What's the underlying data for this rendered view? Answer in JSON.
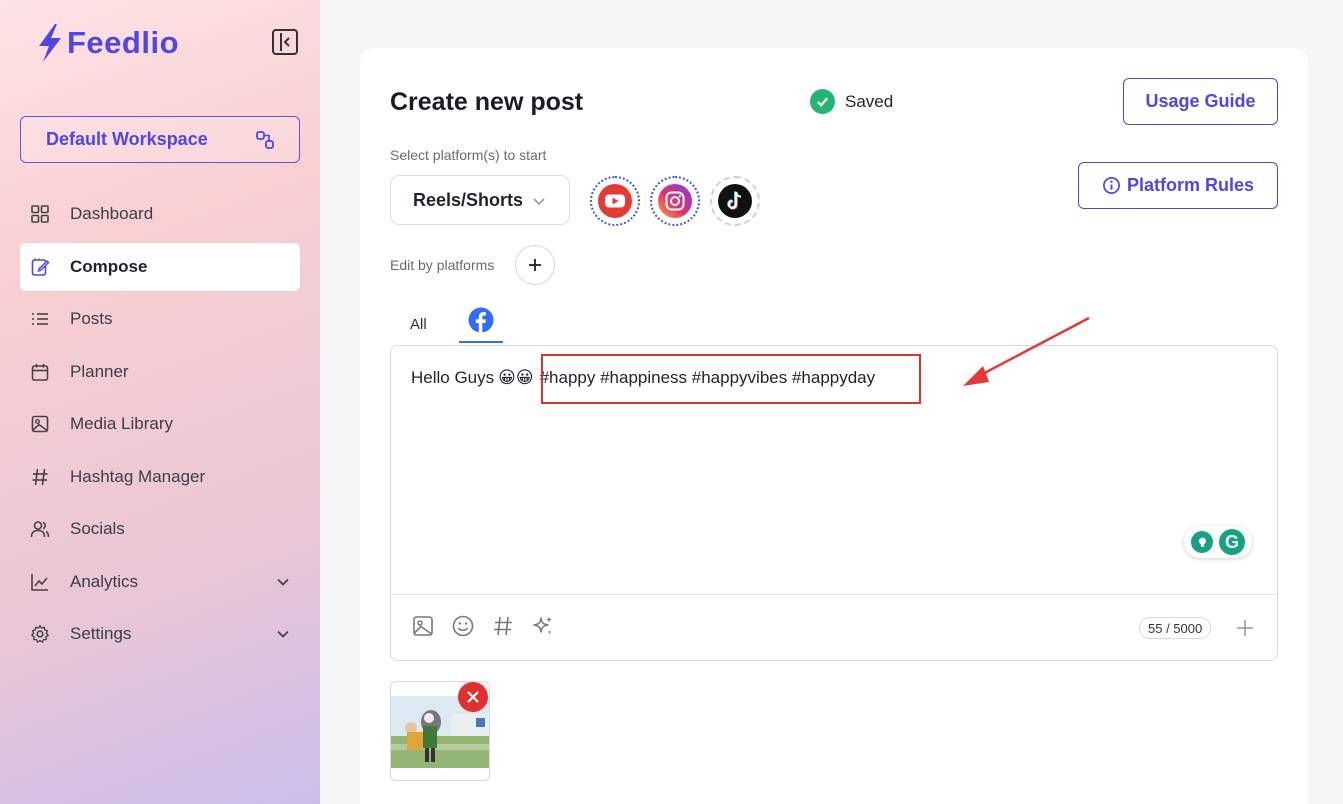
{
  "sidebar": {
    "logo_text": "Feedlio",
    "workspace_label": "Default Workspace",
    "items": [
      {
        "label": "Dashboard",
        "icon": "grid-icon"
      },
      {
        "label": "Compose",
        "icon": "edit-icon",
        "active": true
      },
      {
        "label": "Posts",
        "icon": "list-icon"
      },
      {
        "label": "Planner",
        "icon": "calendar-icon"
      },
      {
        "label": "Media Library",
        "icon": "image-icon"
      },
      {
        "label": "Hashtag Manager",
        "icon": "hash-icon"
      },
      {
        "label": "Socials",
        "icon": "users-icon"
      },
      {
        "label": "Analytics",
        "icon": "chart-icon",
        "expandable": true
      },
      {
        "label": "Settings",
        "icon": "gear-icon",
        "expandable": true
      }
    ]
  },
  "main": {
    "title": "Create new post",
    "saved_label": "Saved",
    "usage_guide_label": "Usage Guide",
    "platform_rules_label": "Platform Rules",
    "select_platform_label": "Select platform(s) to start",
    "post_type": "Reels/Shorts",
    "platforms": [
      "youtube",
      "instagram",
      "tiktok"
    ],
    "edit_by_platforms_label": "Edit by platforms",
    "tabs": [
      {
        "label": "All"
      },
      {
        "label": "",
        "icon": "facebook-icon",
        "active": true
      }
    ],
    "editor": {
      "text_prefix": "Hello Guys",
      "emojis": "😀😀",
      "hashtags": "#happy #happiness #happyvibes #happyday",
      "char_count": "55 / 5000"
    }
  },
  "colors": {
    "accent": "#4f46e5",
    "saved_green": "#22b573",
    "highlight_red": "#e03131",
    "facebook_blue": "#2f6df3"
  }
}
